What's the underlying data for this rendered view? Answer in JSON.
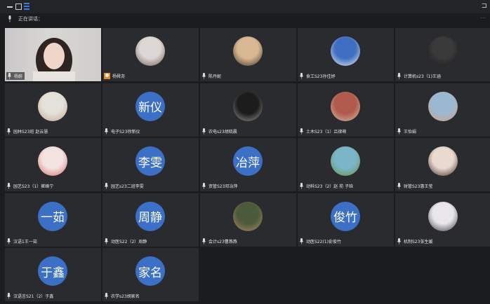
{
  "toolbar": {
    "right_glyph": "⊐"
  },
  "status": {
    "text": "正在讲话：",
    "right_glyph": "⋯"
  },
  "participants": [
    {
      "name": "杨蔚",
      "avatar_type": "video",
      "mic_on": true
    },
    {
      "name": "杨舜尧",
      "avatar_type": "photo",
      "photo_colors": [
        "#dcd6d4",
        "#6a5a54"
      ],
      "host": true
    },
    {
      "name": "陈丹妮",
      "avatar_type": "photo",
      "photo_colors": [
        "#d8b893",
        "#3a2d24"
      ]
    },
    {
      "name": "食工S23孙佳妤",
      "avatar_type": "photo",
      "photo_colors": [
        "#3f6ec0",
        "#f4f4f4"
      ]
    },
    {
      "name": "计算机s23（1)王涵",
      "avatar_type": "photo",
      "photo_colors": [
        "#3a3a3a",
        "#181818"
      ]
    },
    {
      "name": "园林S23班 赵云慧",
      "avatar_type": "photo",
      "photo_colors": [
        "#e4e0da",
        "#c2a48e"
      ]
    },
    {
      "name": "电子S23徐新仪",
      "avatar_type": "text",
      "avatar_text": "新仪"
    },
    {
      "name": "农电s23胡晓晨",
      "avatar_type": "photo",
      "photo_colors": [
        "#1c1c1c",
        "#9a9a9a"
      ]
    },
    {
      "name": "土木S23（1）吕律萌",
      "avatar_type": "photo",
      "photo_colors": [
        "#b05a4e",
        "#d8c2a8"
      ]
    },
    {
      "name": "王怡娟",
      "avatar_type": "photo",
      "photo_colors": [
        "#9bb8d2",
        "#d69e83"
      ]
    },
    {
      "name": "园艺S23（1）崔峰宁",
      "avatar_type": "photo",
      "photo_colors": [
        "#f2e2e0",
        "#d46a6a"
      ]
    },
    {
      "name": "园艺s23二班李雯",
      "avatar_type": "text",
      "avatar_text": "李雯"
    },
    {
      "name": "资管S23邓冶萍",
      "avatar_type": "text",
      "avatar_text": "冶萍"
    },
    {
      "name": "动科S23（2）赵 苑 子晗",
      "avatar_type": "photo",
      "photo_colors": [
        "#7bb6c8",
        "#6c8d44"
      ]
    },
    {
      "name": "财管S23惠王莹",
      "avatar_type": "photo",
      "photo_colors": [
        "#e9d9cf",
        "#3a2a26"
      ]
    },
    {
      "name": "汉语1王一茹",
      "avatar_type": "text",
      "avatar_text": "一茹"
    },
    {
      "name": "动医S22（2）周静",
      "avatar_type": "text",
      "avatar_text": "周静"
    },
    {
      "name": "会计s23曹燕燕",
      "avatar_type": "photo",
      "photo_colors": [
        "#4b5a3a",
        "#b38a66"
      ]
    },
    {
      "name": "动医S22(1)俞俊竹",
      "avatar_type": "text",
      "avatar_text": "俊竹"
    },
    {
      "name": "机制S23张生媛",
      "avatar_type": "photo",
      "photo_colors": [
        "#e8e6ea",
        "#3a3440"
      ]
    },
    {
      "name": "汉语言S21（2）于鑫",
      "avatar_type": "text",
      "avatar_text": "于鑫"
    },
    {
      "name": "农学s23胡家名",
      "avatar_type": "text",
      "avatar_text": "家名"
    }
  ]
}
